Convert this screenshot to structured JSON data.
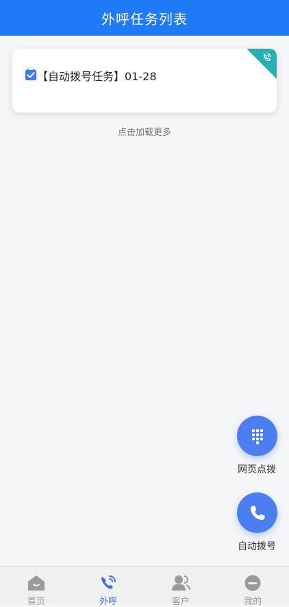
{
  "header": {
    "title": "外呼任务列表"
  },
  "task_list": {
    "items": [
      {
        "title": "【自动拨号任务】01-28",
        "icon": "check-icon",
        "badge_icon": "phone-call-icon"
      }
    ],
    "load_more_label": "点击加载更多"
  },
  "fabs": {
    "web_dial_label": "网页点拨",
    "web_dial_icon": "dialpad-icon",
    "auto_dial_label": "自动拨号",
    "auto_dial_icon": "phone-icon"
  },
  "tabbar": {
    "tabs": [
      {
        "label": "首页",
        "icon": "home-icon",
        "active": false
      },
      {
        "label": "外呼",
        "icon": "phone-call-icon",
        "active": true
      },
      {
        "label": "客户",
        "icon": "contacts-icon",
        "active": false
      },
      {
        "label": "我的",
        "icon": "profile-icon",
        "active": false
      }
    ]
  },
  "colors": {
    "primary": "#1f7af7",
    "fab": "#4c7ef1",
    "badge": "#27b0b3",
    "tab_active": "#3e6ff2",
    "tab_inactive": "#999999"
  }
}
